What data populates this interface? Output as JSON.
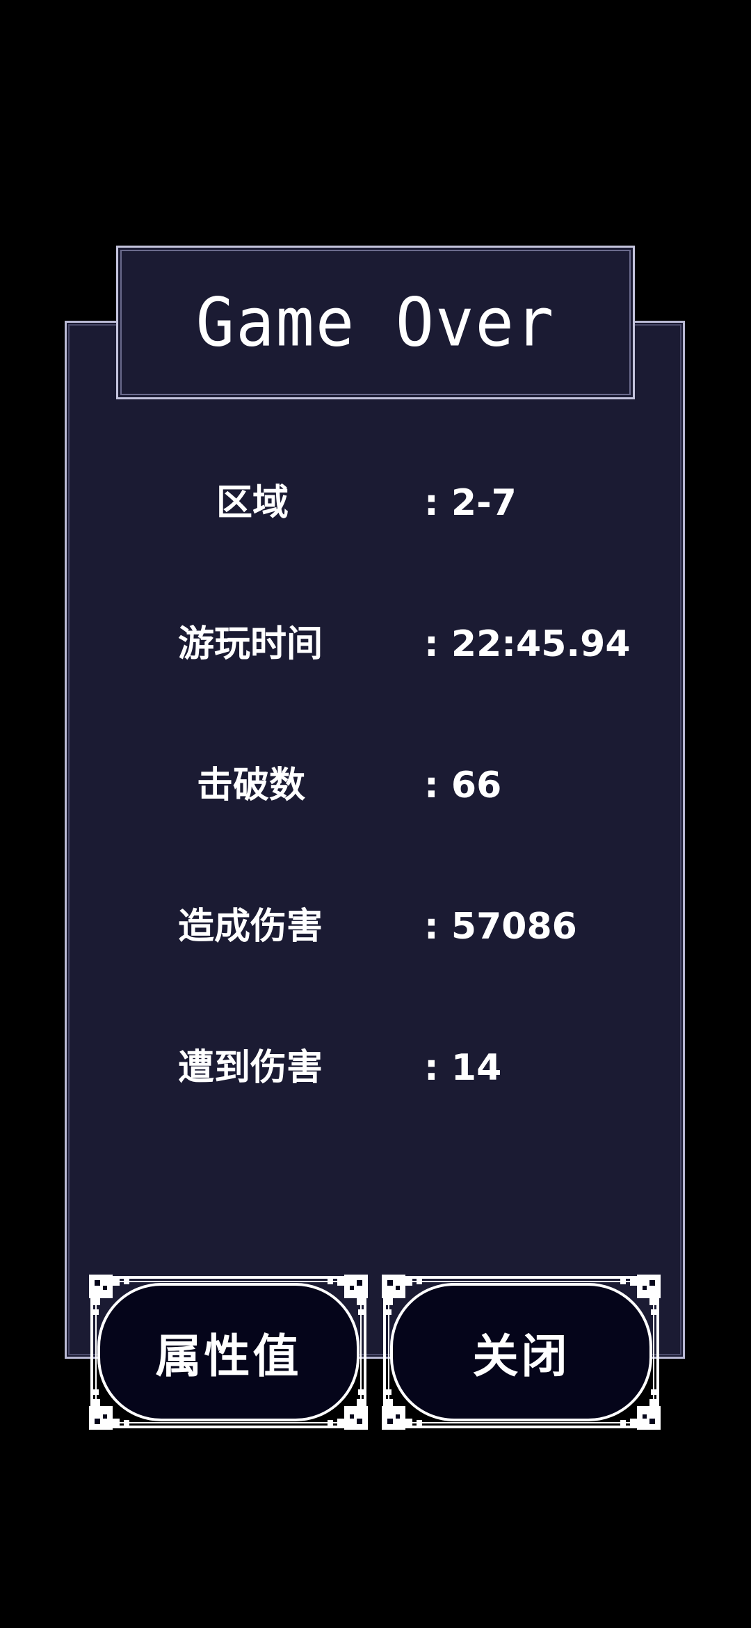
{
  "dialog": {
    "title": "Game Over"
  },
  "stats": [
    {
      "label": "区域",
      "value": ": 2-7"
    },
    {
      "label": "游玩时间",
      "value": ": 22:45.94"
    },
    {
      "label": "击破数",
      "value": ": 66"
    },
    {
      "label": "造成伤害",
      "value": ": 57086"
    },
    {
      "label": "遭到伤害",
      "value": ": 14"
    }
  ],
  "buttons": {
    "attributes_label": "属性值",
    "close_label": "关闭"
  },
  "colors": {
    "background": "#000000",
    "panel": "#1b1b33",
    "border": "#c4c4dd",
    "button_fill": "#05051a",
    "text": "#ffffff"
  }
}
